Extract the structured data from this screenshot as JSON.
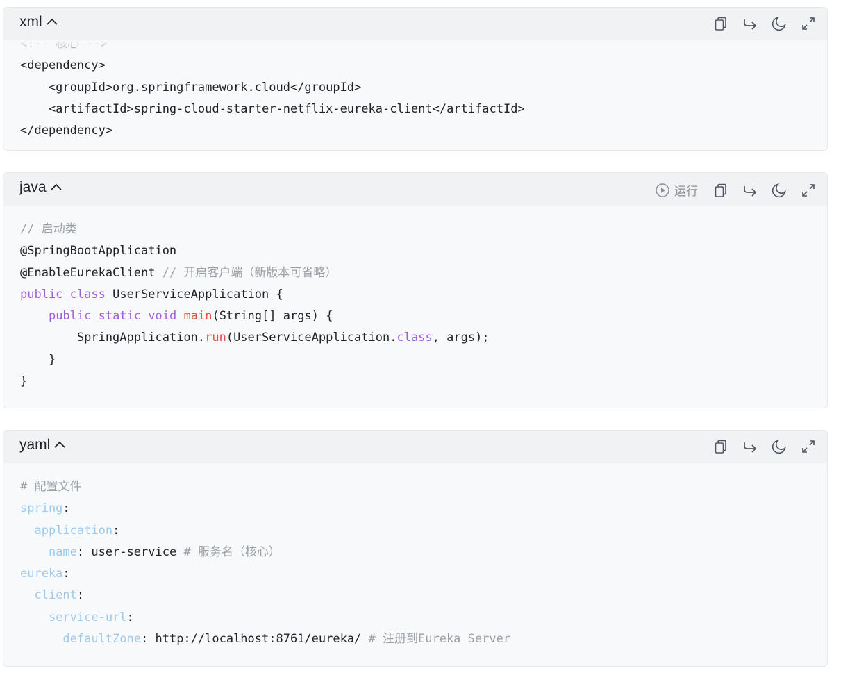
{
  "blocks": [
    {
      "language": "xml",
      "lines": [
        "<!-- 核心 -->",
        "<dependency>",
        "    <groupId>org.springframework.cloud</groupId>",
        "    <artifactId>spring-cloud-starter-netflix-eureka-client</artifactId>",
        "</dependency>"
      ]
    },
    {
      "language": "java",
      "run_label": "运行",
      "lines": [
        "// 启动类",
        "@SpringBootApplication",
        "@EnableEurekaClient // 开启客户端（新版本可省略）",
        "public class UserServiceApplication {",
        "    public static void main(String[] args) {",
        "        SpringApplication.run(UserServiceApplication.class, args);",
        "    }",
        "}"
      ]
    },
    {
      "language": "yaml",
      "lines": [
        "# 配置文件",
        "spring:",
        "  application:",
        "    name: user-service # 服务名（核心）",
        "eureka:",
        "  client:",
        "    service-url:",
        "      defaultZone: http://localhost:8761/eureka/ # 注册到Eureka Server"
      ]
    }
  ],
  "icons": [
    "chevron-up-icon",
    "copy-icon",
    "share-icon",
    "dark-mode-icon",
    "fullscreen-icon",
    "play-icon"
  ],
  "colors": {
    "keyword": "#a15fd6",
    "function": "#e0533f",
    "comment": "#9aa0a6",
    "yaml_key": "#9ecbec",
    "header_bg": "#f1f2f4",
    "code_bg": "#f8f9fb"
  }
}
